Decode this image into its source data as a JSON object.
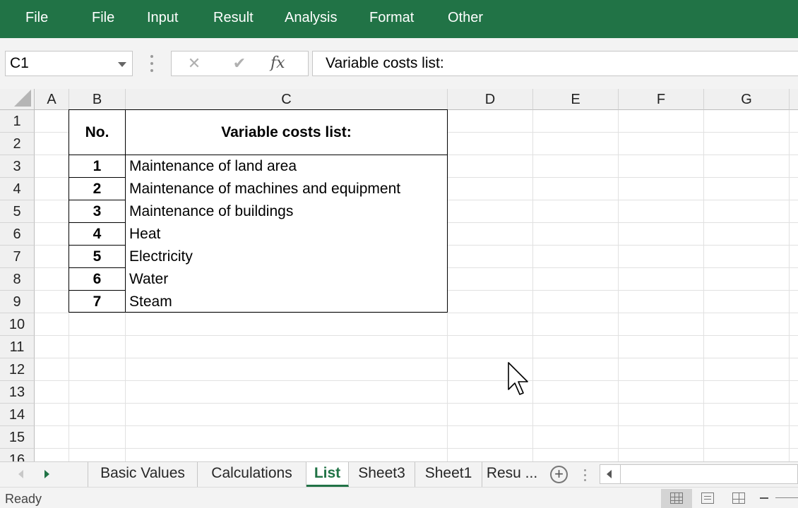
{
  "ribbon": {
    "bg_color": "#217346",
    "menu": [
      "File",
      "File",
      "Input",
      "Result",
      "Analysis",
      "Format",
      "Other"
    ]
  },
  "formula_bar": {
    "name_box": "C1",
    "cancel_icon": "✕",
    "enter_icon": "✔",
    "fx_label": "fx",
    "formula": "Variable costs list:"
  },
  "sheet": {
    "columns": [
      "A",
      "B",
      "C",
      "D",
      "E",
      "F",
      "G"
    ],
    "rows": [
      "1",
      "2",
      "3",
      "4",
      "5",
      "6",
      "7",
      "8",
      "9",
      "10",
      "11",
      "12",
      "13",
      "14",
      "15",
      "16"
    ],
    "table": {
      "header_no": "No.",
      "header_title": "Variable costs list:",
      "items": [
        {
          "no": "1",
          "name": "Maintenance of land area"
        },
        {
          "no": "2",
          "name": "Maintenance of machines and equipment"
        },
        {
          "no": "3",
          "name": "Maintenance of buildings"
        },
        {
          "no": "4",
          "name": "Heat"
        },
        {
          "no": "5",
          "name": "Electricity"
        },
        {
          "no": "6",
          "name": "Water"
        },
        {
          "no": "7",
          "name": "Steam"
        }
      ]
    }
  },
  "tabs": {
    "items": [
      "Basic Values",
      "Calculations",
      "List",
      "Sheet3",
      "Sheet1",
      "Resu ..."
    ],
    "active": "List",
    "add_icon": "+"
  },
  "status": {
    "text": "Ready"
  }
}
